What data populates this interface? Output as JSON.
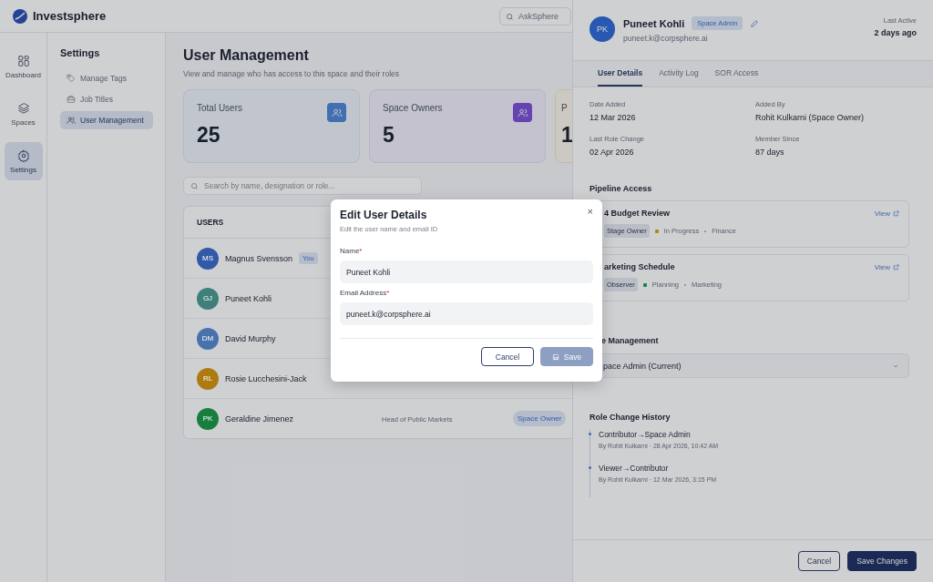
{
  "brand": {
    "name": "Investsphere"
  },
  "top_search": {
    "placeholder": "AskSphere"
  },
  "rail": [
    {
      "label": "Dashboard",
      "selected": false
    },
    {
      "label": "Spaces",
      "selected": false
    },
    {
      "label": "Settings",
      "selected": true
    }
  ],
  "settings_nav": {
    "title": "Settings",
    "items": [
      {
        "label": "Manage Tags",
        "selected": false
      },
      {
        "label": "Job Titles",
        "selected": false
      },
      {
        "label": "User Management",
        "selected": true
      }
    ]
  },
  "page": {
    "title": "User Management",
    "subtitle": "View and manage  who has access to this space and their roles"
  },
  "stats": [
    {
      "label": "Total Users",
      "value": "25",
      "kind": "blue"
    },
    {
      "label": "Space Owners",
      "value": "5",
      "kind": "purple"
    },
    {
      "label": "P",
      "value": "1",
      "kind": "amber"
    }
  ],
  "user_search": {
    "placeholder": "Search by name, designation or role..."
  },
  "users_table": {
    "header": "USERS",
    "rows": [
      {
        "initials": "MS",
        "name": "Magnus Svensson",
        "color": "#3259a7",
        "badge": "You"
      },
      {
        "initials": "GJ",
        "name": "Puneet Kohli",
        "color": "#3e7f7a"
      },
      {
        "initials": "DM",
        "name": "David Murphy",
        "color": "#4972ad"
      },
      {
        "initials": "RL",
        "name": "Rosie Lucchesini-Jack",
        "color": "#ae7b10"
      },
      {
        "initials": "PK",
        "name": "Geraldine Jimenez",
        "color": "#197e3d",
        "designation": "Head of Public Markets",
        "role": "Space Owner"
      }
    ]
  },
  "detail_panel": {
    "initials": "PK",
    "name": "Puneet Kohli",
    "role_badge": "Space Admin",
    "email": "puneet.k@corpsphere.ai",
    "last_active_label": "Last Active",
    "last_active": "2 days ago",
    "tabs": [
      {
        "label": "User Details",
        "selected": true
      },
      {
        "label": "Activity Log",
        "selected": false
      },
      {
        "label": "SOR Access",
        "selected": false
      }
    ],
    "facts": [
      {
        "label": "Date Added",
        "value": "12 Mar 2026"
      },
      {
        "label": "Added By",
        "value": "Rohit Kulkarni (Space Owner)"
      },
      {
        "label": "Last Role Change",
        "value": "02 Apr 2026"
      },
      {
        "label": "Member Since",
        "value": "87 days"
      }
    ],
    "pipeline_heading": "Pipeline Access",
    "pipelines": [
      {
        "name": "4 Budget Review",
        "link": "View",
        "role": "Stage Owner",
        "status": "In Progress",
        "color": "#b3841e",
        "area": "Finance"
      },
      {
        "name": "arketing Schedule",
        "link": "View",
        "role": "Observer",
        "status": "Planning",
        "color": "#1b8248",
        "area": "Marketing"
      }
    ],
    "role_heading": "e Management",
    "role_value": "pace Admin (Current)",
    "history_heading": "Role Change History",
    "history": [
      {
        "change": "Contributor→Space Admin",
        "meta": "By Rohit Kulkarni · 28 Apr 2026, 10:42 AM"
      },
      {
        "change": "Viewer→Contributor",
        "meta": "By Rohit Kulkarni · 12 Mar 2026, 3:15 PM"
      }
    ],
    "buttons": [
      {
        "label": "Cancel",
        "kind": "secondary"
      },
      {
        "label": "Save Changes",
        "kind": "primary"
      }
    ]
  },
  "modal": {
    "title": "Edit User Details",
    "subtitle": "Edit the user name and email ID",
    "close": "×",
    "fields": [
      {
        "label": "Name",
        "required_mark": "*",
        "value": "Puneet Kohli"
      },
      {
        "label": "Email Address",
        "required_mark": "*",
        "value": "puneet.k@corpsphere.ai"
      }
    ],
    "buttons": [
      {
        "label": "Cancel",
        "kind": "secondary",
        "disabled": false
      },
      {
        "label": "Save",
        "kind": "primary",
        "disabled": true
      }
    ]
  }
}
